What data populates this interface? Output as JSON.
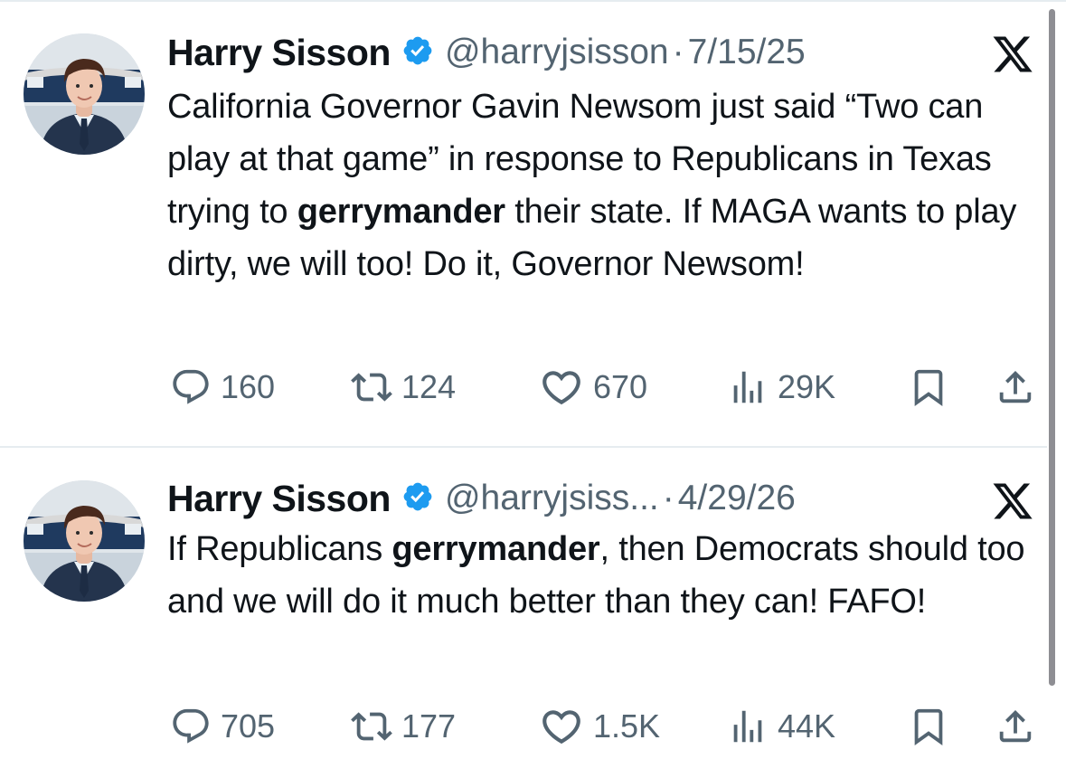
{
  "colors": {
    "text": "#0f1419",
    "secondary": "#536471",
    "verified_badge": "#1d9bf0",
    "divider": "#e6ecf0"
  },
  "icons": {
    "reply": "speech-bubble-icon",
    "repost": "repost-arrows-icon",
    "like": "heart-icon",
    "views": "bar-chart-icon",
    "bookmark": "bookmark-icon",
    "share": "share-upload-icon",
    "brand": "x-logo-icon",
    "verified": "verified-badge-icon"
  },
  "tweets": [
    {
      "author": "Harry Sisson",
      "handle": "@harryjsisson",
      "separator": "·",
      "date": "7/15/25",
      "text": {
        "p1": "California Governor Gavin Newsom just said “Two can play at that game” in response to Republicans in Texas trying to ",
        "bold": "gerrymander",
        "p2": " their state. If MAGA wants to play dirty, we will too! Do it, Governor Newsom!"
      },
      "counts": {
        "replies": "160",
        "reposts": "124",
        "likes": "670",
        "views": "29K"
      }
    },
    {
      "author": "Harry Sisson",
      "handle": "@harryjsiss...",
      "separator": "·",
      "date": "4/29/26",
      "text": {
        "p1": "If Republicans ",
        "bold": "gerrymander",
        "p2": ", then Democrats should too and we will do it much better than they can! FAFO!"
      },
      "counts": {
        "replies": "705",
        "reposts": "177",
        "likes": "1.5K",
        "views": "44K"
      }
    }
  ]
}
